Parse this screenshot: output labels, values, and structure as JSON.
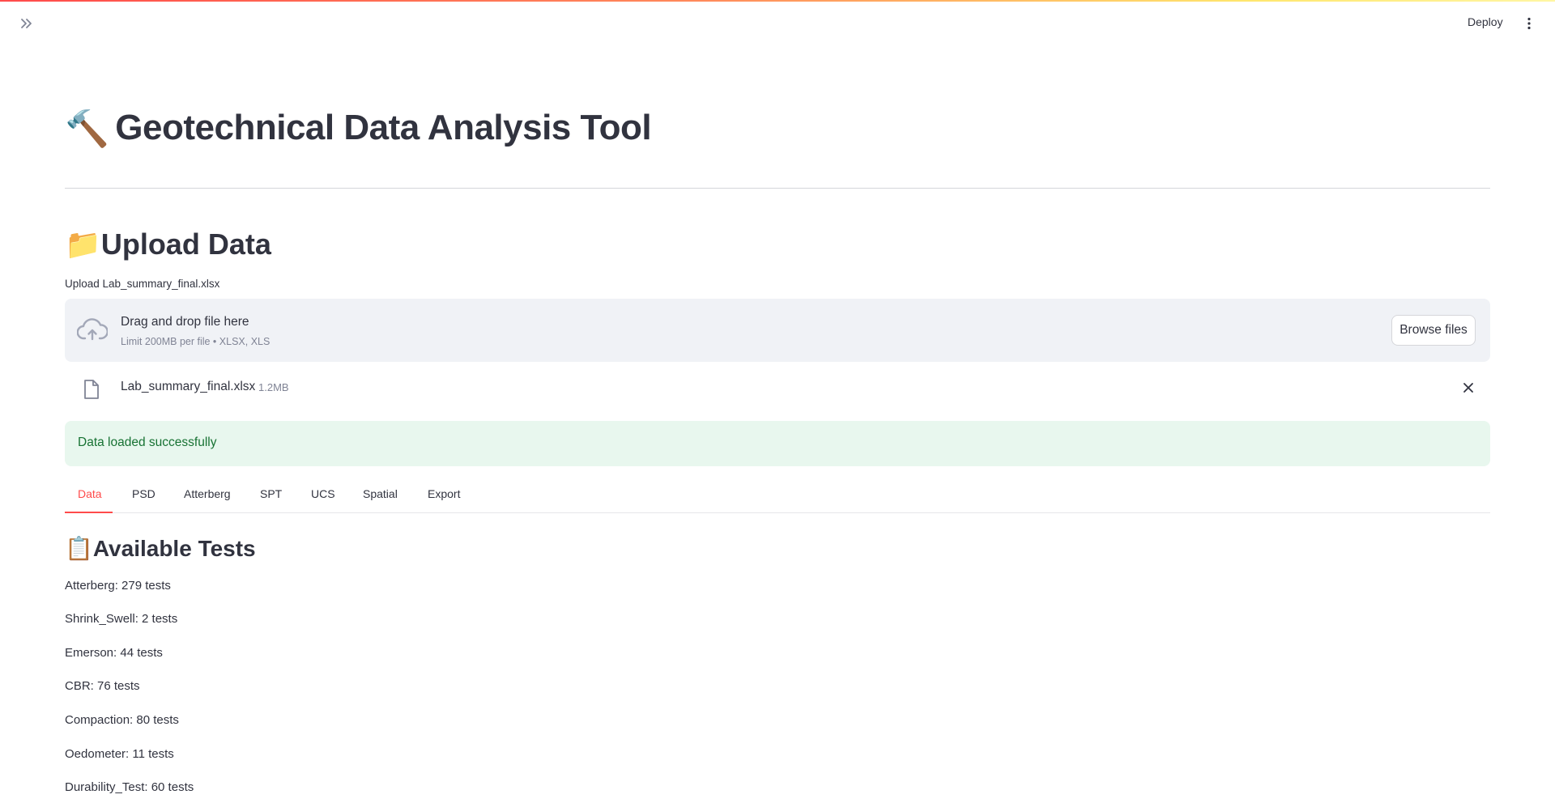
{
  "header": {
    "deploy_label": "Deploy"
  },
  "page": {
    "title": "Geotechnical Data Analysis Tool",
    "title_emoji": "🔨"
  },
  "upload": {
    "heading": "Upload Data",
    "heading_emoji": "📁",
    "label": "Upload Lab_summary_final.xlsx",
    "drop_text": "Drag and drop file here",
    "limit_text": "Limit 200MB per file • XLSX, XLS",
    "browse_label": "Browse files",
    "file": {
      "name": "Lab_summary_final.xlsx",
      "size": "1.2MB"
    }
  },
  "alert": {
    "message": "Data loaded successfully",
    "color": "#177233"
  },
  "tabs": {
    "active": "Data",
    "items": [
      "Data",
      "PSD",
      "Atterberg",
      "SPT",
      "UCS",
      "Spatial",
      "Export"
    ]
  },
  "available": {
    "heading": "Available Tests",
    "heading_emoji": "📋",
    "tests": [
      "Atterberg: 279 tests",
      "Shrink_Swell: 2 tests",
      "Emerson: 44 tests",
      "CBR: 76 tests",
      "Compaction: 80 tests",
      "Oedometer: 11 tests",
      "Durability_Test: 60 tests"
    ]
  },
  "colors": {
    "accent": "#ff4b4b",
    "text": "#31333f",
    "muted": "#808495",
    "success_bg": "#e8f7ee"
  }
}
